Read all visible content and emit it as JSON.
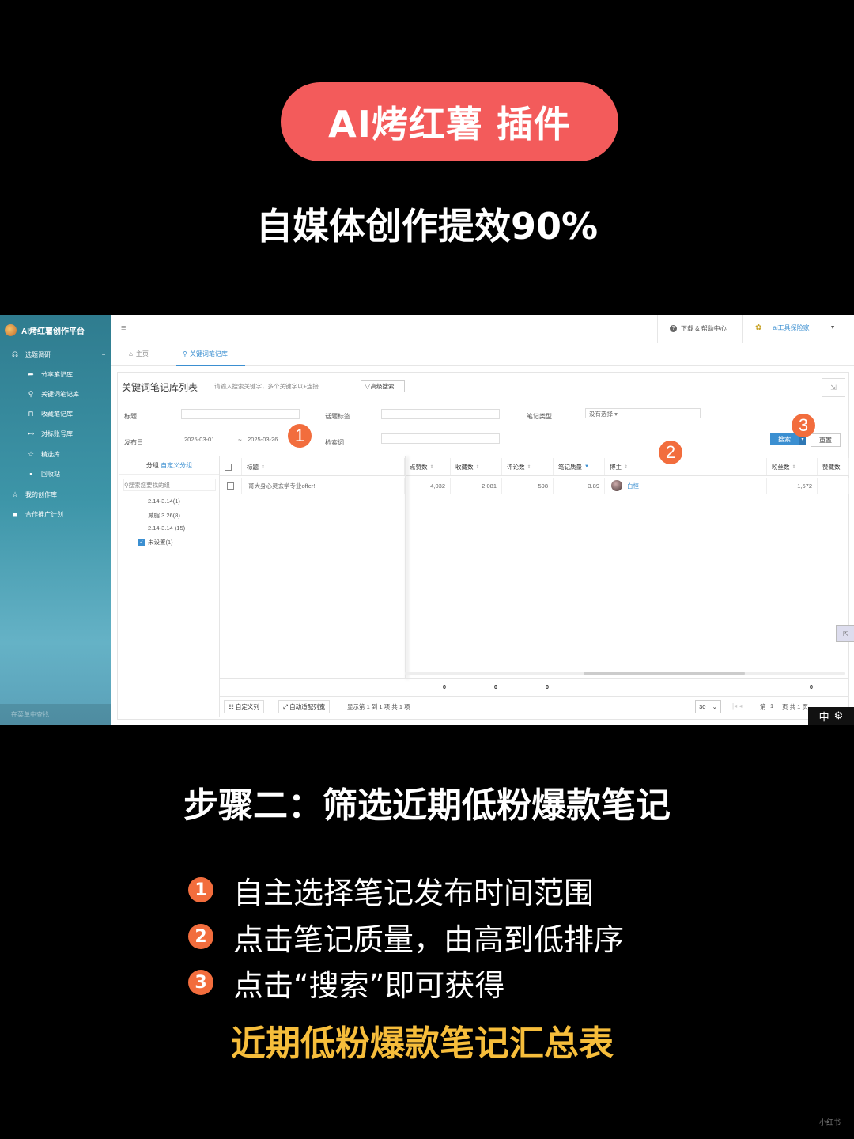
{
  "header": {
    "pill_title": "AI烤红薯 插件",
    "subtitle": "自媒体创作提效90%"
  },
  "app": {
    "brand": "AI烤红薯创作平台",
    "menu_icon": "hamburger-icon",
    "topbar": {
      "help": "下载 & 帮助中心",
      "user": "ai工具探险家"
    },
    "sidebar": {
      "group": "选题调研",
      "items": [
        {
          "label": "分享笔记库",
          "icon": "share-icon"
        },
        {
          "label": "关键词笔记库",
          "icon": "search-icon"
        },
        {
          "label": "收藏笔记库",
          "icon": "bookmark-icon"
        },
        {
          "label": "对标账号库",
          "icon": "dumbbell-icon"
        },
        {
          "label": "精选库",
          "icon": "star-icon"
        },
        {
          "label": "回收站",
          "icon": "trash-icon"
        }
      ],
      "bottom_items": [
        {
          "label": "我的创作库",
          "icon": "star-icon"
        },
        {
          "label": "合作推广计划",
          "icon": "video-icon"
        }
      ],
      "search": "在菜单中查找"
    },
    "tabs": {
      "home": "主页",
      "active": "关键词笔记库"
    },
    "panel": {
      "title": "关键词笔记库列表",
      "search_placeholder": "请输入搜索关键字，多个关键字以+连接",
      "advanced": "高级搜索",
      "filters": {
        "title_label": "标题",
        "topic_label": "话题标签",
        "type_label": "笔记类型",
        "type_value": "没有选择",
        "date_label": "发布日",
        "date_from": "2025-03-01",
        "date_sep": "~",
        "date_to": "2025-03-26",
        "keyword_label": "检索词",
        "search_btn": "搜索",
        "reset_btn": "重置"
      },
      "group_panel": {
        "header": "分组",
        "custom": "自定义分组",
        "search_placeholder": "搜索您要找的组",
        "groups": [
          {
            "label": "2.14-3.14(1)",
            "checked": false
          },
          {
            "label": "减脂 3.26(8)",
            "checked": false
          },
          {
            "label": "2.14-3.14 (15)",
            "checked": false
          },
          {
            "label": "未设置(1)",
            "checked": true
          }
        ]
      },
      "table": {
        "columns": [
          "标题",
          "点赞数",
          "收藏数",
          "评论数",
          "笔记质量",
          "博主",
          "粉丝数",
          "赞藏数"
        ],
        "rows": [
          {
            "title": "哥大身心灵玄学专业offer!",
            "likes": "4,032",
            "collects": "2,081",
            "comments": "598",
            "quality": "3.89",
            "author": "白恒",
            "fans": "1,572"
          }
        ],
        "totals": [
          "0",
          "0",
          "0",
          "0"
        ]
      },
      "footer": {
        "custom_cols": "自定义列",
        "auto_width": "自动适配列宽",
        "summary": "显示第 1 到 1 项 共 1 项",
        "page_size": "30",
        "page_label": "第",
        "page_num": "1",
        "page_total": "页 共 1 页"
      },
      "ime": "中"
    }
  },
  "annotations": {
    "badge1": "1",
    "badge2": "2",
    "badge3": "3"
  },
  "steps": {
    "title": "步骤二：筛选近期低粉爆款笔记",
    "items": [
      {
        "num": "1",
        "text": "自主选择笔记发布时间范围"
      },
      {
        "num": "2",
        "text": "点击笔记质量，由高到低排序"
      },
      {
        "num": "3",
        "text": "点击“搜索”即可获得"
      }
    ],
    "highlight": "近期低粉爆款笔记汇总表"
  },
  "watermark": "小红书"
}
